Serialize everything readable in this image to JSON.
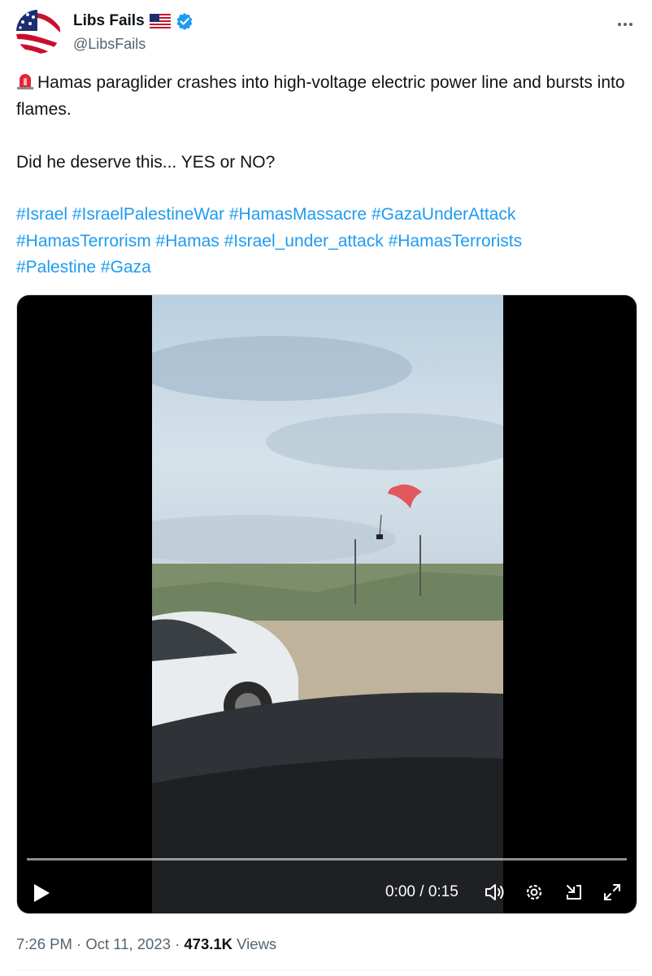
{
  "author": {
    "display_name": "Libs Fails",
    "flag": "us-flag-icon",
    "handle": "@LibsFails",
    "verified_color": "#1d9bf0"
  },
  "tweet": {
    "siren": "rotating-light-icon",
    "text_line1": "Hamas paraglider crashes into high-voltage electric power line and bursts into flames.",
    "text_line2": "Did he deserve this... YES or NO?",
    "hashtags": [
      "#Israel",
      "#IsraelPalestineWar",
      "#HamasMassacre",
      "#GazaUnderAttack",
      "#HamasTerrorism",
      "#Hamas",
      "#Israel_under_attack",
      "#HamasTerrorists",
      "#Palestine",
      "#Gaza"
    ]
  },
  "video": {
    "current_time": "0:00",
    "duration": "0:15",
    "time_display": "0:00 / 0:15",
    "progress": 0
  },
  "meta": {
    "time": "7:26 PM",
    "date": "Oct 11, 2023",
    "views_count": "473.1K",
    "views_label": "Views"
  },
  "colors": {
    "link": "#1d9bf0",
    "muted": "#536471",
    "text": "#0f1419"
  }
}
